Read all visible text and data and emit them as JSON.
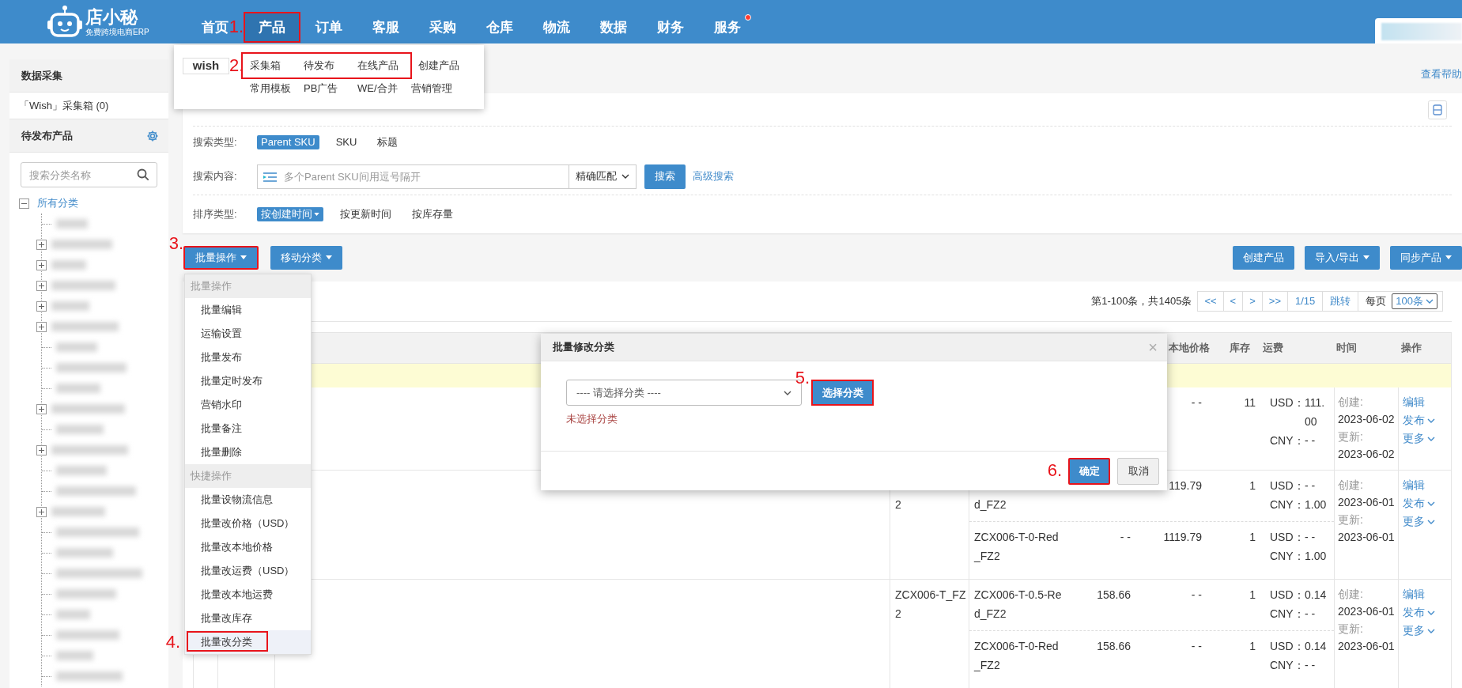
{
  "header": {
    "logo": {
      "name": "店小秘",
      "tagline": "免费跨境电商ERP"
    },
    "nav": [
      {
        "label": "首页",
        "selected": false,
        "highlighted": false,
        "badge": false
      },
      {
        "label": "产品",
        "selected": true,
        "highlighted": true,
        "badge": false,
        "step": "1."
      },
      {
        "label": "订单",
        "selected": false,
        "highlighted": false,
        "badge": false
      },
      {
        "label": "客服",
        "selected": false,
        "highlighted": false,
        "badge": false
      },
      {
        "label": "采购",
        "selected": false,
        "highlighted": false,
        "badge": false
      },
      {
        "label": "仓库",
        "selected": false,
        "highlighted": false,
        "badge": false
      },
      {
        "label": "物流",
        "selected": false,
        "highlighted": false,
        "badge": false
      },
      {
        "label": "数据",
        "selected": false,
        "highlighted": false,
        "badge": false
      },
      {
        "label": "财务",
        "selected": false,
        "highlighted": false,
        "badge": false
      },
      {
        "label": "服务",
        "selected": false,
        "highlighted": false,
        "badge": true
      }
    ]
  },
  "product_menu": {
    "platform": "wish",
    "step": "2.",
    "rows": [
      [
        {
          "label": "采集箱",
          "highlighted": true
        },
        {
          "label": "待发布",
          "highlighted": true
        },
        {
          "label": "在线产品",
          "highlighted": true
        },
        {
          "label": "创建产品",
          "highlighted": false
        }
      ],
      [
        {
          "label": "常用模板",
          "highlighted": false
        },
        {
          "label": "PB广告",
          "highlighted": false
        },
        {
          "label": "WE/合并",
          "highlighted": false
        },
        {
          "label": "营销管理",
          "highlighted": false
        }
      ]
    ]
  },
  "sidebar": {
    "sections": [
      {
        "title": "数据采集",
        "settings": false,
        "items": [
          "「Wish」采集箱 (0)"
        ]
      },
      {
        "title": "待发布产品",
        "settings": true
      }
    ],
    "search": {
      "placeholder": "搜索分类名称"
    },
    "tree": {
      "label": "所有分类",
      "expanded": true,
      "children": [
        {
          "kind": "leaf"
        },
        {
          "kind": "folder",
          "expanded": false
        },
        {
          "kind": "folder",
          "expanded": false
        },
        {
          "kind": "folder",
          "expanded": false
        },
        {
          "kind": "folder",
          "expanded": false
        },
        {
          "kind": "folder",
          "expanded": false
        },
        {
          "kind": "leaf"
        },
        {
          "kind": "leaf"
        },
        {
          "kind": "leaf"
        },
        {
          "kind": "folder",
          "expanded": false
        },
        {
          "kind": "leaf"
        },
        {
          "kind": "folder",
          "expanded": false
        },
        {
          "kind": "leaf"
        },
        {
          "kind": "leaf"
        },
        {
          "kind": "folder",
          "expanded": false
        },
        {
          "kind": "leaf"
        },
        {
          "kind": "leaf"
        },
        {
          "kind": "leaf"
        },
        {
          "kind": "leaf"
        },
        {
          "kind": "leaf"
        },
        {
          "kind": "leaf"
        },
        {
          "kind": "leaf"
        },
        {
          "kind": "leaf"
        }
      ]
    }
  },
  "help_link": "查看帮助",
  "filters": {
    "search_type": {
      "label": "搜索类型:",
      "options": [
        {
          "label": "Parent SKU",
          "selected": true
        },
        {
          "label": "SKU",
          "selected": false
        },
        {
          "label": "标题",
          "selected": false
        }
      ]
    },
    "search_content": {
      "label": "搜索内容:",
      "placeholder": "多个Parent SKU间用逗号隔开",
      "match": "精确匹配",
      "button": "搜索",
      "advanced": "高级搜索"
    },
    "sort": {
      "label": "排序类型:",
      "options": [
        {
          "label": "按创建时间",
          "selected": true
        },
        {
          "label": "按更新时间",
          "selected": false
        },
        {
          "label": "按库存量",
          "selected": false
        }
      ]
    }
  },
  "toolbar": {
    "left": [
      {
        "label": "批量操作",
        "highlighted": true,
        "step": "3."
      },
      {
        "label": "移动分类",
        "highlighted": false
      }
    ],
    "right": [
      {
        "label": "创建产品",
        "caret": false
      },
      {
        "label": "导入/导出",
        "caret": true
      },
      {
        "label": "同步产品",
        "caret": true
      }
    ]
  },
  "batch_menu": {
    "groups": [
      {
        "title": "批量操作",
        "items": [
          {
            "label": "批量编辑",
            "highlighted": false
          },
          {
            "label": "运输设置",
            "highlighted": false
          },
          {
            "label": "批量发布",
            "highlighted": false
          },
          {
            "label": "批量定时发布",
            "highlighted": false
          },
          {
            "label": "营销水印",
            "highlighted": false
          },
          {
            "label": "批量备注",
            "highlighted": false
          },
          {
            "label": "批量删除",
            "highlighted": false
          }
        ]
      },
      {
        "title": "快捷操作",
        "items": [
          {
            "label": "批量设物流信息",
            "highlighted": false
          },
          {
            "label": "批量改价格（USD）",
            "highlighted": false
          },
          {
            "label": "批量改本地价格",
            "highlighted": false
          },
          {
            "label": "批量改运费（USD）",
            "highlighted": false
          },
          {
            "label": "批量改本地运费",
            "highlighted": false
          },
          {
            "label": "批量改库存",
            "highlighted": false
          },
          {
            "label": "批量改分类",
            "highlighted": true,
            "step": "4."
          }
        ]
      }
    ]
  },
  "pagination": {
    "summary": "第1-100条，共1405条",
    "buttons": [
      "<<",
      "<",
      ">",
      ">>"
    ],
    "page": "1/15",
    "jump": "跳转",
    "per_page_label": "每页",
    "per_page": "100条"
  },
  "table": {
    "columns": [
      "本地价格",
      "库存",
      "运费",
      "时间",
      "操作"
    ],
    "rows": [
      {
        "variants": [
          {
            "local_price": "- -",
            "stock": "11",
            "usd_label": "USD：",
            "usd": "111.00",
            "cny_label": "CNY：",
            "cny": "- -"
          }
        ],
        "created_label": "创建:",
        "created": "2023-06-02",
        "updated_label": "更新:",
        "updated": "2023-06-02",
        "actions": [
          {
            "label": "编辑",
            "caret": false
          },
          {
            "label": "发布",
            "caret": true
          },
          {
            "label": "更多",
            "caret": true
          }
        ]
      },
      {
        "parent_sku_cont": "2",
        "variants": [
          {
            "sku_cont": "d_FZ2",
            "local_price": "119.79",
            "stock": "1",
            "usd_label": "USD：",
            "usd": "- -",
            "cny_label": "CNY：",
            "cny": "1.00"
          },
          {
            "sku": "ZCX006-T-0-Red_FZ2",
            "price": "- -",
            "local_price": "1119.79",
            "stock": "1",
            "usd_label": "USD：",
            "usd": "- -",
            "cny_label": "CNY：",
            "cny": "1.00"
          }
        ],
        "created_label": "创建:",
        "created": "2023-06-01",
        "updated_label": "更新:",
        "updated": "2023-06-01",
        "actions": [
          {
            "label": "编辑",
            "caret": false
          },
          {
            "label": "发布",
            "caret": true
          },
          {
            "label": "更多",
            "caret": true
          }
        ]
      },
      {
        "parent_sku": "ZCX006-T_FZ2",
        "variants": [
          {
            "sku": "ZCX006-T-0.5-Red_FZ2",
            "price": "158.66",
            "local_price": "- -",
            "stock": "1",
            "usd_label": "USD：",
            "usd": "0.14",
            "cny_label": "CNY：",
            "cny": "- -"
          },
          {
            "sku": "ZCX006-T-0-Red_FZ2",
            "price": "158.66",
            "local_price": "- -",
            "stock": "1",
            "usd_label": "USD：",
            "usd": "0.14",
            "cny_label": "CNY：",
            "cny": "- -"
          }
        ],
        "created_label": "创建:",
        "created": "2023-06-01",
        "updated_label": "更新:",
        "updated": "2023-06-01",
        "actions": [
          {
            "label": "编辑",
            "caret": false
          },
          {
            "label": "发布",
            "caret": true
          },
          {
            "label": "更多",
            "caret": true
          }
        ]
      }
    ]
  },
  "dialog": {
    "title": "批量修改分类",
    "close": "×",
    "select_placeholder": "---- 请选择分类 ----",
    "choose_button": {
      "label": "选择分类",
      "highlighted": true,
      "step": "5."
    },
    "error": "未选择分类",
    "buttons": [
      {
        "label": "确定",
        "kind": "primary",
        "highlighted": true,
        "step": "6."
      },
      {
        "label": "取消",
        "kind": "default",
        "highlighted": false
      }
    ]
  }
}
